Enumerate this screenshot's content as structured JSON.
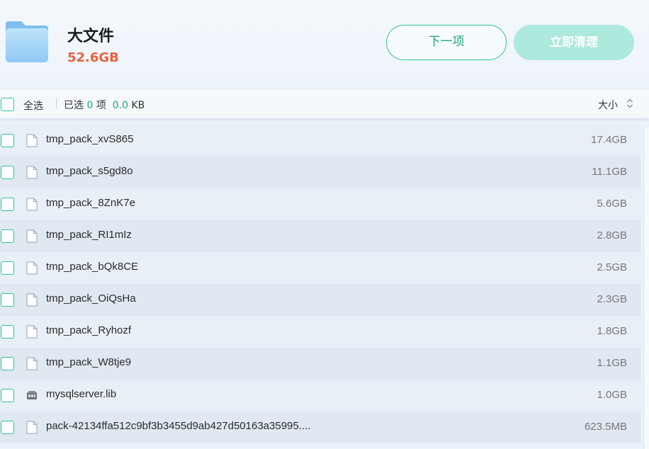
{
  "header": {
    "title": "大文件",
    "total_size": "52.6GB",
    "next_label": "下一项",
    "clean_label": "立即清理",
    "icon": "folder-icon"
  },
  "toolbar": {
    "select_all_label": "全选",
    "selected_prefix": "已选",
    "selected_count": "0",
    "selected_unit": "项",
    "selected_size": "0.0",
    "selected_size_unit": "KB",
    "sort_label": "大小",
    "sort_icon": "sort-updown-icon"
  },
  "files": [
    {
      "name": "tmp_pack_xvS865",
      "size": "17.4GB",
      "icon": "file-icon"
    },
    {
      "name": "tmp_pack_s5gd8o",
      "size": "11.1GB",
      "icon": "file-icon"
    },
    {
      "name": "tmp_pack_8ZnK7e",
      "size": "5.6GB",
      "icon": "file-icon"
    },
    {
      "name": "tmp_pack_RI1mIz",
      "size": "2.8GB",
      "icon": "file-icon"
    },
    {
      "name": "tmp_pack_bQk8CE",
      "size": "2.5GB",
      "icon": "file-icon"
    },
    {
      "name": "tmp_pack_OiQsHa",
      "size": "2.3GB",
      "icon": "file-icon"
    },
    {
      "name": "tmp_pack_Ryhozf",
      "size": "1.8GB",
      "icon": "file-icon"
    },
    {
      "name": "tmp_pack_W8tje9",
      "size": "1.1GB",
      "icon": "file-icon"
    },
    {
      "name": "mysqlserver.lib",
      "size": "1.0GB",
      "icon": "library-file-icon"
    },
    {
      "name": "pack-42134ffa512c9bf3b3455d9ab427d50163a35995....",
      "size": "623.5MB",
      "icon": "file-icon"
    }
  ],
  "colors": {
    "accent": "#2cc3a0",
    "size_highlight": "#e8633e",
    "clean_button_disabled": "#ade9dc"
  }
}
